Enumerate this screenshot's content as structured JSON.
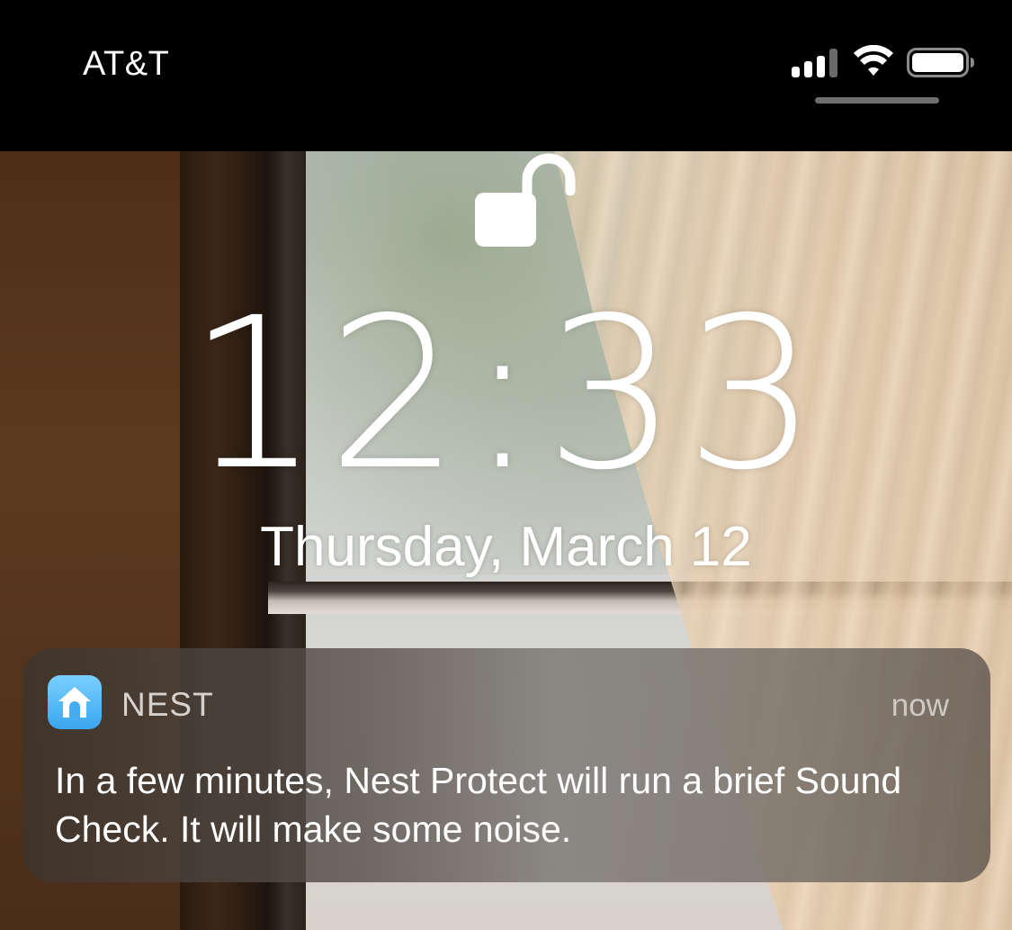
{
  "status_bar": {
    "carrier": "AT&T",
    "signal_bars_filled": 3,
    "signal_bars_total": 4,
    "wifi_icon": "wifi-icon",
    "battery_icon": "battery-icon"
  },
  "lock_screen": {
    "lock_icon": "unlocked-padlock-icon",
    "time": "12:33",
    "date": "Thursday, March 12"
  },
  "notification": {
    "app_icon": "nest-home-icon",
    "app_name": "NEST",
    "time": "now",
    "body": "In a few minutes, Nest Protect will run a brief Sound Check. It will make some noise."
  },
  "colors": {
    "nest_icon_top": "#7ad0ff",
    "nest_icon_bottom": "#3aa6ee"
  }
}
